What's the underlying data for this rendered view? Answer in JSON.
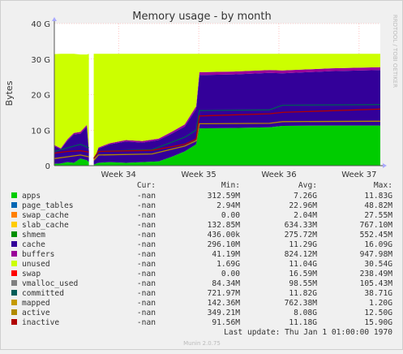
{
  "colors": {
    "background": "#f0f0f0",
    "plot_background": "#ffffff",
    "grid": "#ff9a9a",
    "axis": "#555555",
    "text": "#333333",
    "footer": "#bbbbbb"
  },
  "chart_data": {
    "type": "area",
    "title": "Memory usage - by month",
    "ylabel": "Bytes",
    "xlabel": "",
    "side_text": "RRDTOOL / TOBI OETIKER",
    "ylim": [
      0,
      40000000000
    ],
    "y_ticks": [
      {
        "value": 0,
        "label": "0"
      },
      {
        "value": 10000000000,
        "label": "10 G"
      },
      {
        "value": 20000000000,
        "label": "20 G"
      },
      {
        "value": 30000000000,
        "label": "30 G"
      },
      {
        "value": 40000000000,
        "label": "40 G"
      }
    ],
    "xlim": [
      0,
      100
    ],
    "x_ticks": [
      {
        "value": 19.7,
        "label": "Week 34"
      },
      {
        "value": 44.3,
        "label": "Week 35"
      },
      {
        "value": 68.9,
        "label": "Week 36"
      },
      {
        "value": 93.5,
        "label": "Week 37"
      }
    ],
    "gaps": [
      [
        10.6,
        12.1
      ]
    ],
    "grid": true,
    "legend_position": "bottom",
    "legend_header": {
      "cur": "Cur:",
      "min": "Min:",
      "avg": "Avg:",
      "max": "Max:"
    },
    "series": [
      {
        "name": "apps",
        "color": "#00cc00",
        "cur": "-nan",
        "min": "312.59M",
        "avg": "7.26G",
        "max": "11.83G"
      },
      {
        "name": "page_tables",
        "color": "#0066b3",
        "cur": "-nan",
        "min": "2.94M",
        "avg": "22.96M",
        "max": "48.82M"
      },
      {
        "name": "swap_cache",
        "color": "#ff8000",
        "cur": "-nan",
        "min": "0.00",
        "avg": "2.04M",
        "max": "27.55M"
      },
      {
        "name": "slab_cache",
        "color": "#ffcc00",
        "cur": "-nan",
        "min": "132.85M",
        "avg": "634.33M",
        "max": "767.10M"
      },
      {
        "name": "shmem",
        "color": "#008f00",
        "cur": "-nan",
        "min": "436.00k",
        "avg": "275.72M",
        "max": "552.45M"
      },
      {
        "name": "cache",
        "color": "#330099",
        "cur": "-nan",
        "min": "296.10M",
        "avg": "11.29G",
        "max": "16.09G"
      },
      {
        "name": "buffers",
        "color": "#990099",
        "cur": "-nan",
        "min": "41.19M",
        "avg": "824.12M",
        "max": "947.98M"
      },
      {
        "name": "unused",
        "color": "#ccff00",
        "cur": "-nan",
        "min": "1.69G",
        "avg": "11.04G",
        "max": "30.54G"
      },
      {
        "name": "swap",
        "color": "#ff0000",
        "cur": "-nan",
        "min": "0.00",
        "avg": "16.59M",
        "max": "238.49M"
      },
      {
        "name": "vmalloc_used",
        "color": "#808080",
        "cur": "-nan",
        "min": "84.34M",
        "avg": "98.55M",
        "max": "105.43M"
      },
      {
        "name": "committed",
        "color": "#005d57",
        "cur": "-nan",
        "min": "721.97M",
        "avg": "11.82G",
        "max": "38.71G"
      },
      {
        "name": "mapped",
        "color": "#c49a00",
        "cur": "-nan",
        "min": "142.36M",
        "avg": "762.38M",
        "max": "1.20G"
      },
      {
        "name": "active",
        "color": "#b08a00",
        "cur": "-nan",
        "min": "349.21M",
        "avg": "8.08G",
        "max": "12.50G"
      },
      {
        "name": "inactive",
        "color": "#b00000",
        "cur": "-nan",
        "min": "91.56M",
        "avg": "11.18G",
        "max": "15.90G"
      }
    ],
    "stack_profile": [
      {
        "x": 0.0,
        "apps": 0.5,
        "cache": 5.0,
        "buffers": 0.3,
        "unused": 25.6
      },
      {
        "x": 2.0,
        "apps": 0.6,
        "cache": 4.0,
        "buffers": 0.3,
        "unused": 26.6
      },
      {
        "x": 4.0,
        "apps": 1.0,
        "cache": 6.0,
        "buffers": 0.4,
        "unused": 24.1
      },
      {
        "x": 6.0,
        "apps": 0.8,
        "cache": 8.0,
        "buffers": 0.4,
        "unused": 22.3
      },
      {
        "x": 8.0,
        "apps": 2.0,
        "cache": 7.0,
        "buffers": 0.5,
        "unused": 21.8
      },
      {
        "x": 10.0,
        "apps": 1.5,
        "cache": 9.5,
        "buffers": 0.5,
        "unused": 19.8
      },
      {
        "x": 10.6,
        "apps": 1.0,
        "cache": 3.0,
        "buffers": 0.4,
        "unused": 27.1
      },
      {
        "x": 12.1,
        "apps": 0.3,
        "cache": 1.0,
        "buffers": 0.1,
        "unused": 30.1
      },
      {
        "x": 13.5,
        "apps": 0.8,
        "cache": 4.0,
        "buffers": 0.3,
        "unused": 26.4
      },
      {
        "x": 17.0,
        "apps": 1.0,
        "cache": 5.0,
        "buffers": 0.3,
        "unused": 25.2
      },
      {
        "x": 22.0,
        "apps": 0.8,
        "cache": 6.0,
        "buffers": 0.4,
        "unused": 24.3
      },
      {
        "x": 27.0,
        "apps": 1.0,
        "cache": 5.5,
        "buffers": 0.4,
        "unused": 24.6
      },
      {
        "x": 32.0,
        "apps": 1.2,
        "cache": 6.0,
        "buffers": 0.4,
        "unused": 23.9
      },
      {
        "x": 36.0,
        "apps": 2.5,
        "cache": 6.5,
        "buffers": 0.5,
        "unused": 22.0
      },
      {
        "x": 40.0,
        "apps": 4.0,
        "cache": 7.0,
        "buffers": 0.6,
        "unused": 19.9
      },
      {
        "x": 43.5,
        "apps": 6.0,
        "cache": 10.0,
        "buffers": 0.7,
        "unused": 14.8
      },
      {
        "x": 44.5,
        "apps": 10.5,
        "cache": 15.0,
        "buffers": 0.8,
        "unused": 5.2
      },
      {
        "x": 55.0,
        "apps": 10.6,
        "cache": 15.1,
        "buffers": 0.8,
        "unused": 5.0
      },
      {
        "x": 66.0,
        "apps": 10.8,
        "cache": 15.3,
        "buffers": 0.8,
        "unused": 4.6
      },
      {
        "x": 70.0,
        "apps": 11.2,
        "cache": 14.8,
        "buffers": 0.8,
        "unused": 4.7
      },
      {
        "x": 85.0,
        "apps": 11.3,
        "cache": 15.3,
        "buffers": 0.8,
        "unused": 4.1
      },
      {
        "x": 100.0,
        "apps": 11.3,
        "cache": 15.6,
        "buffers": 0.8,
        "unused": 3.8
      }
    ],
    "line_profile": [
      {
        "x": 0.0,
        "committed": 4.0,
        "active": 2.0,
        "inactive": 3.5
      },
      {
        "x": 4.0,
        "committed": 5.0,
        "active": 2.5,
        "inactive": 4.0
      },
      {
        "x": 8.0,
        "committed": 6.0,
        "active": 3.0,
        "inactive": 4.2
      },
      {
        "x": 10.6,
        "committed": 5.0,
        "active": 2.5,
        "inactive": 3.8
      },
      {
        "x": 12.1,
        "committed": 2.0,
        "active": 1.5,
        "inactive": 2.0
      },
      {
        "x": 13.5,
        "committed": 4.0,
        "active": 3.0,
        "inactive": 4.0
      },
      {
        "x": 30.0,
        "committed": 4.5,
        "active": 3.3,
        "inactive": 4.3
      },
      {
        "x": 40.0,
        "committed": 8.0,
        "active": 5.5,
        "inactive": 6.0
      },
      {
        "x": 43.5,
        "committed": 10.0,
        "active": 7.0,
        "inactive": 7.5
      },
      {
        "x": 44.5,
        "committed": 15.5,
        "active": 11.8,
        "inactive": 14.0
      },
      {
        "x": 66.0,
        "committed": 15.7,
        "active": 11.9,
        "inactive": 14.6
      },
      {
        "x": 70.0,
        "committed": 17.0,
        "active": 12.4,
        "inactive": 15.0
      },
      {
        "x": 100.0,
        "committed": 17.2,
        "active": 12.5,
        "inactive": 15.9
      }
    ]
  },
  "footer": {
    "last_update": "Last update: Thu Jan  1 01:00:00 1970",
    "munin": "Munin 2.0.75"
  }
}
